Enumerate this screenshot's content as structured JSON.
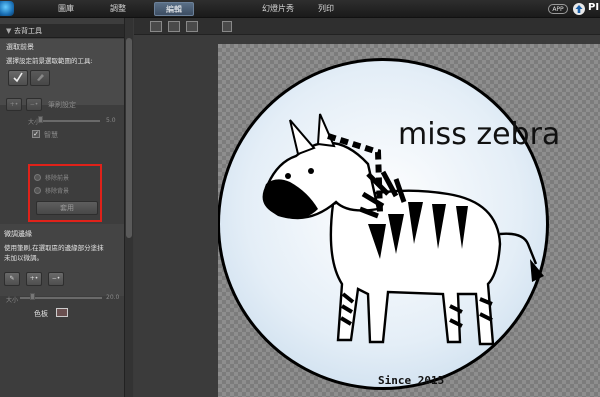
{
  "topbar": {
    "tabs": [
      {
        "label": "圖庫"
      },
      {
        "label": "調整"
      },
      {
        "label": "編輯",
        "active": true
      },
      {
        "label": "幻燈片秀"
      },
      {
        "label": "列印"
      }
    ],
    "app_badge": "APP",
    "brand": "PI"
  },
  "panel": {
    "header_title": "去背工具",
    "section_title": "選取前景",
    "instruction": "選擇設定前景選取範圍的工具:",
    "brush_size_label": "筆刷設定",
    "size_label": "大小",
    "size_value": "5.0",
    "smart_label": "智慧",
    "radio_remove_fg": "移除前景",
    "radio_remove_bg": "移除背景",
    "apply_label": "套用",
    "refine_title": "微調邊緣",
    "refine_desc_1": "使用筆刷,在選取區的邊緣部分塗抹",
    "refine_desc_2": "未加以微調。",
    "refine_size_label": "大小",
    "refine_size_value": "20.0",
    "color_label": "色板"
  },
  "artwork": {
    "title": "miss zebra",
    "footer": "Since 2015"
  },
  "colors": {
    "highlight": "#e0221a",
    "active_tab": "#4a5e75"
  }
}
